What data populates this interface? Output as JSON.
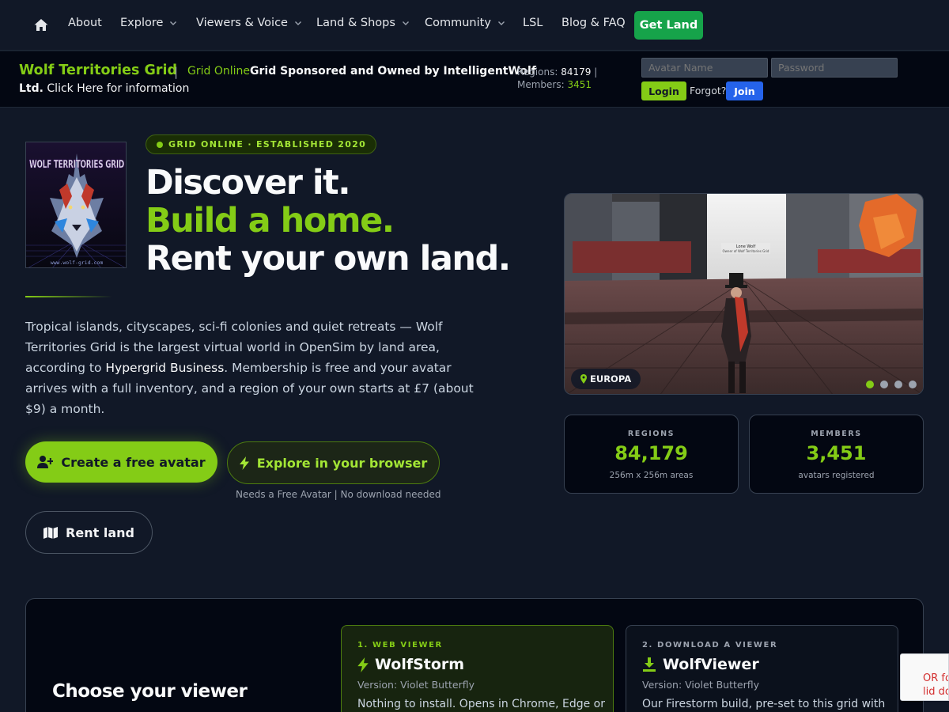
{
  "nav": {
    "items": [
      {
        "label": "About",
        "dropdown": false
      },
      {
        "label": "Explore",
        "dropdown": true
      },
      {
        "label": "Viewers & Voice",
        "dropdown": true
      },
      {
        "label": "Land & Shops",
        "dropdown": true
      },
      {
        "label": "Community",
        "dropdown": true
      },
      {
        "label": "LSL",
        "dropdown": false
      },
      {
        "label": "Blog & FAQ",
        "dropdown": false
      }
    ],
    "cta": "Get Land"
  },
  "infobar": {
    "grid_name": "Wolf Territories Grid",
    "separator": "|",
    "status": "Grid Online",
    "sponsor_line_1": "Grid Sponsored and Owned by IntelligentWolf",
    "sponsor_line_2_bold": "Ltd.",
    "sponsor_line_2_rest": "Click Here for information",
    "regions_label": "Regions:",
    "regions_value": "84179",
    "regions_pipe": "|",
    "members_label": "Members:",
    "members_value": "3451",
    "avatar_placeholder": "Avatar Name",
    "password_placeholder": "Password",
    "login": "Login",
    "forgot": "Forgot?",
    "join": "Join"
  },
  "hero": {
    "logo_text": "WOLF TERRITORIES GRID",
    "logo_url": "www.wolf-grid.com",
    "badge": "GRID ONLINE · ESTABLISHED 2020",
    "line1": "Discover it.",
    "line2": "Build a home.",
    "line3": "Rent your own land.",
    "intro_a": "Tropical islands, cityscapes, sci-fi colonies and quiet retreats — Wolf Territories Grid is the largest virtual world in OpenSim by land area, according to ",
    "intro_link": "Hypergrid Business",
    "intro_b": ". Membership is free and your avatar arrives with a full inventory, and a region of your own starts at £7 (about $9) a month.",
    "btn_create": "Create a free avatar",
    "btn_explore": "Explore in your browser",
    "explore_note": "Needs a Free Avatar | No download needed",
    "btn_rent": "Rent land"
  },
  "gallery": {
    "location": "EUROPA",
    "nameplate_1": "Lone Wolf",
    "nameplate_2": "Owner of Wolf Territories Grid",
    "slide_count": 4,
    "active_slide": 1
  },
  "stats": [
    {
      "label": "REGIONS",
      "value": "84,179",
      "sub": "256m x 256m areas"
    },
    {
      "label": "MEMBERS",
      "value": "3,451",
      "sub": "avatars registered"
    }
  ],
  "viewers": {
    "heading": "Choose your viewer",
    "cards": [
      {
        "step": "1. WEB VIEWER",
        "name": "WolfStorm",
        "version": "Version: Violet Butterfly",
        "desc": "Nothing to install. Opens in Chrome, Edge or"
      },
      {
        "step": "2. DOWNLOAD A VIEWER",
        "name": "WolfViewer",
        "version": "Version: Violet Butterfly",
        "desc": "Our Firestorm build, pre-set to this grid with"
      }
    ]
  },
  "captcha": {
    "line1": "OR fo",
    "line2": "lid do"
  },
  "colors": {
    "accent": "#84cc16",
    "accent_dark": "#16a34a",
    "join_blue": "#2563eb",
    "background": "#111827"
  }
}
